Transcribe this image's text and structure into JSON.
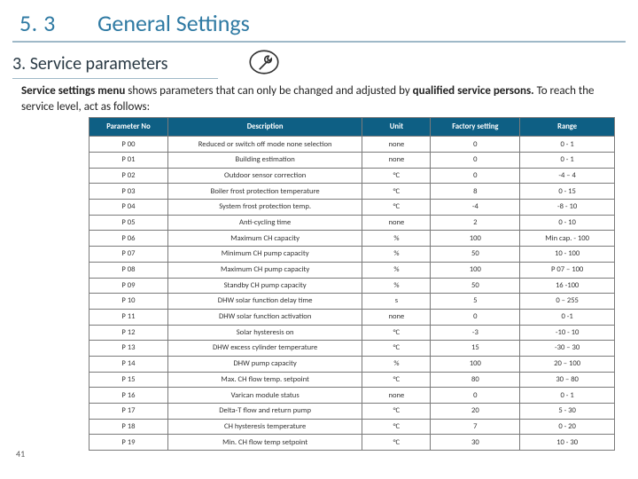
{
  "header": {
    "section_number": "5. 3",
    "title": "General Settings"
  },
  "subtitle": "3. Service parameters",
  "intro_html": "<b>Service settings menu</b> shows parameters that can only be changed and adjusted by <b>qualified service persons.</b> To reach the service level, act as follows:",
  "page_number": "41",
  "icon_name": "wrench-icon",
  "table": {
    "columns": [
      "Parameter No",
      "Description",
      "Unit",
      "Factory setting",
      "Range"
    ],
    "rows": [
      {
        "no": "P 00",
        "desc": "Reduced or switch off mode none selection",
        "unit": "none",
        "factory": "0",
        "range": "0 - 1"
      },
      {
        "no": "P 01",
        "desc": "Building estimation",
        "unit": "none",
        "factory": "0",
        "range": "0 - 1"
      },
      {
        "no": "P 02",
        "desc": "Outdoor sensor correction",
        "unit": "°C",
        "factory": "0",
        "range": "-4 – 4"
      },
      {
        "no": "P 03",
        "desc": "Boiler frost protection temperature",
        "unit": "°C",
        "factory": "8",
        "range": "0 - 15"
      },
      {
        "no": "P 04",
        "desc": "System frost protection temp.",
        "unit": "°C",
        "factory": "-4",
        "range": "-8 - 10"
      },
      {
        "no": "P 05",
        "desc": "Anti-cycling time",
        "unit": "none",
        "factory": "2",
        "range": "0 - 10"
      },
      {
        "no": "P 06",
        "desc": "Maximum CH capacity",
        "unit": "%",
        "factory": "100",
        "range": "Min cap. - 100"
      },
      {
        "no": "P 07",
        "desc": "Minimum CH pump capacity",
        "unit": "%",
        "factory": "50",
        "range": "10 - 100"
      },
      {
        "no": "P 08",
        "desc": "Maximum CH pump capacity",
        "unit": "%",
        "factory": "100",
        "range": "P 07 – 100"
      },
      {
        "no": "P 09",
        "desc": "Standby CH pump capacity",
        "unit": "%",
        "factory": "50",
        "range": "16 -100"
      },
      {
        "no": "P 10",
        "desc": "DHW solar function delay time",
        "unit": "s",
        "factory": "5",
        "range": "0 – 255"
      },
      {
        "no": "P 11",
        "desc": "DHW solar function activation",
        "unit": "none",
        "factory": "0",
        "range": "0 -1"
      },
      {
        "no": "P 12",
        "desc": "Solar hysteresis on",
        "unit": "°C",
        "factory": "-3",
        "range": "-10 - 10"
      },
      {
        "no": "P 13",
        "desc": "DHW excess cylinder temperature",
        "unit": "°C",
        "factory": "15",
        "range": "-30 – 30"
      },
      {
        "no": "P 14",
        "desc": "DHW pump capacity",
        "unit": "%",
        "factory": "100",
        "range": "20 – 100"
      },
      {
        "no": "P 15",
        "desc": "Max. CH flow temp. setpoint",
        "unit": "°C",
        "factory": "80",
        "range": "30 – 80"
      },
      {
        "no": "P 16",
        "desc": "Varican module status",
        "unit": "none",
        "factory": "0",
        "range": "0 - 1"
      },
      {
        "no": "P 17",
        "desc": "Delta-T flow and return pump",
        "unit": "°C",
        "factory": "20",
        "range": "5 - 30"
      },
      {
        "no": "P 18",
        "desc": "CH hysteresis temperature",
        "unit": "°C",
        "factory": "7",
        "range": "0 - 20"
      },
      {
        "no": "P 19",
        "desc": "Min. CH flow temp setpoint",
        "unit": "°C",
        "factory": "30",
        "range": "10 - 30"
      }
    ]
  }
}
